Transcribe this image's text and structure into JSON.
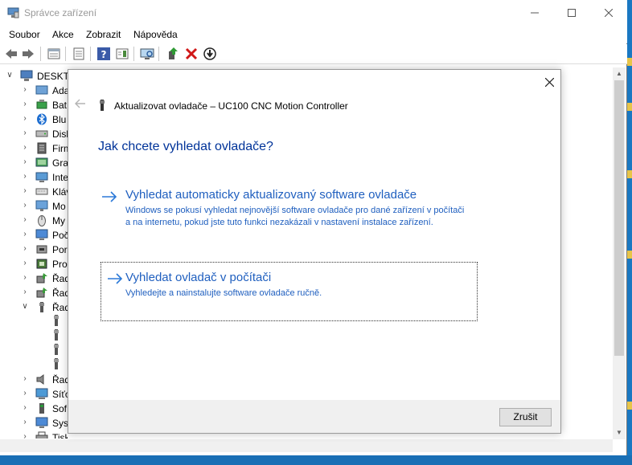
{
  "window": {
    "title": "Správce zařízení"
  },
  "menu": [
    "Soubor",
    "Akce",
    "Zobrazit",
    "Nápověda"
  ],
  "tree": {
    "root": "DESKTO",
    "items": [
      {
        "label": "Ada",
        "icon": "display-adapter-icon",
        "chev": ">"
      },
      {
        "label": "Bat",
        "icon": "battery-icon",
        "chev": ">"
      },
      {
        "label": "Blu",
        "icon": "bluetooth-icon",
        "chev": ">"
      },
      {
        "label": "Disk",
        "icon": "disk-drive-icon",
        "chev": ">"
      },
      {
        "label": "Firm",
        "icon": "firmware-icon",
        "chev": ">"
      },
      {
        "label": "Gra",
        "icon": "graphics-icon",
        "chev": ">"
      },
      {
        "label": "Inte",
        "icon": "network-interface-icon",
        "chev": ">"
      },
      {
        "label": "Kláv",
        "icon": "keyboard-icon",
        "chev": ">"
      },
      {
        "label": "Mo",
        "icon": "monitor-icon",
        "chev": ">"
      },
      {
        "label": "My",
        "icon": "mouse-icon",
        "chev": ">"
      },
      {
        "label": "Poč",
        "icon": "computer-icon",
        "chev": ">"
      },
      {
        "label": "Por",
        "icon": "port-icon",
        "chev": ">"
      },
      {
        "label": "Pro",
        "icon": "processor-icon",
        "chev": ">"
      },
      {
        "label": "Řad",
        "icon": "controller-icon",
        "chev": ">"
      },
      {
        "label": "Řad",
        "icon": "controller-icon",
        "chev": ">"
      },
      {
        "label": "Řad",
        "icon": "usb-controller-icon",
        "chev": "v"
      },
      {
        "label": "Řad",
        "icon": "sound-icon",
        "chev": ">"
      },
      {
        "label": "Síťo",
        "icon": "network-adapter-icon",
        "chev": ">"
      },
      {
        "label": "Sof",
        "icon": "software-device-icon",
        "chev": ">"
      },
      {
        "label": "Sys",
        "icon": "system-device-icon",
        "chev": ">"
      },
      {
        "label": "Tiskové fronty",
        "icon": "print-queue-icon",
        "chev": ">"
      }
    ]
  },
  "dialog": {
    "header": "Aktualizovat ovladače – UC100 CNC Motion Controller",
    "question": "Jak chcete vyhledat ovladače?",
    "option_auto": {
      "title": "Vyhledat automaticky aktualizovaný software ovladače",
      "desc": "Windows se pokusí vyhledat nejnovější software ovladače pro dané zařízení v počítači a na internetu, pokud jste tuto funkci nezakázali v nastavení instalace zařízení."
    },
    "option_manual": {
      "title": "Vyhledat ovladač v počítači",
      "desc": "Vyhledejte a nainstalujte software ovladače ručně."
    },
    "cancel_label": "Zrušit"
  },
  "colors": {
    "link_blue": "#1f5fbf",
    "heading_blue": "#003399",
    "desktop_blue": "#1a78c2"
  }
}
